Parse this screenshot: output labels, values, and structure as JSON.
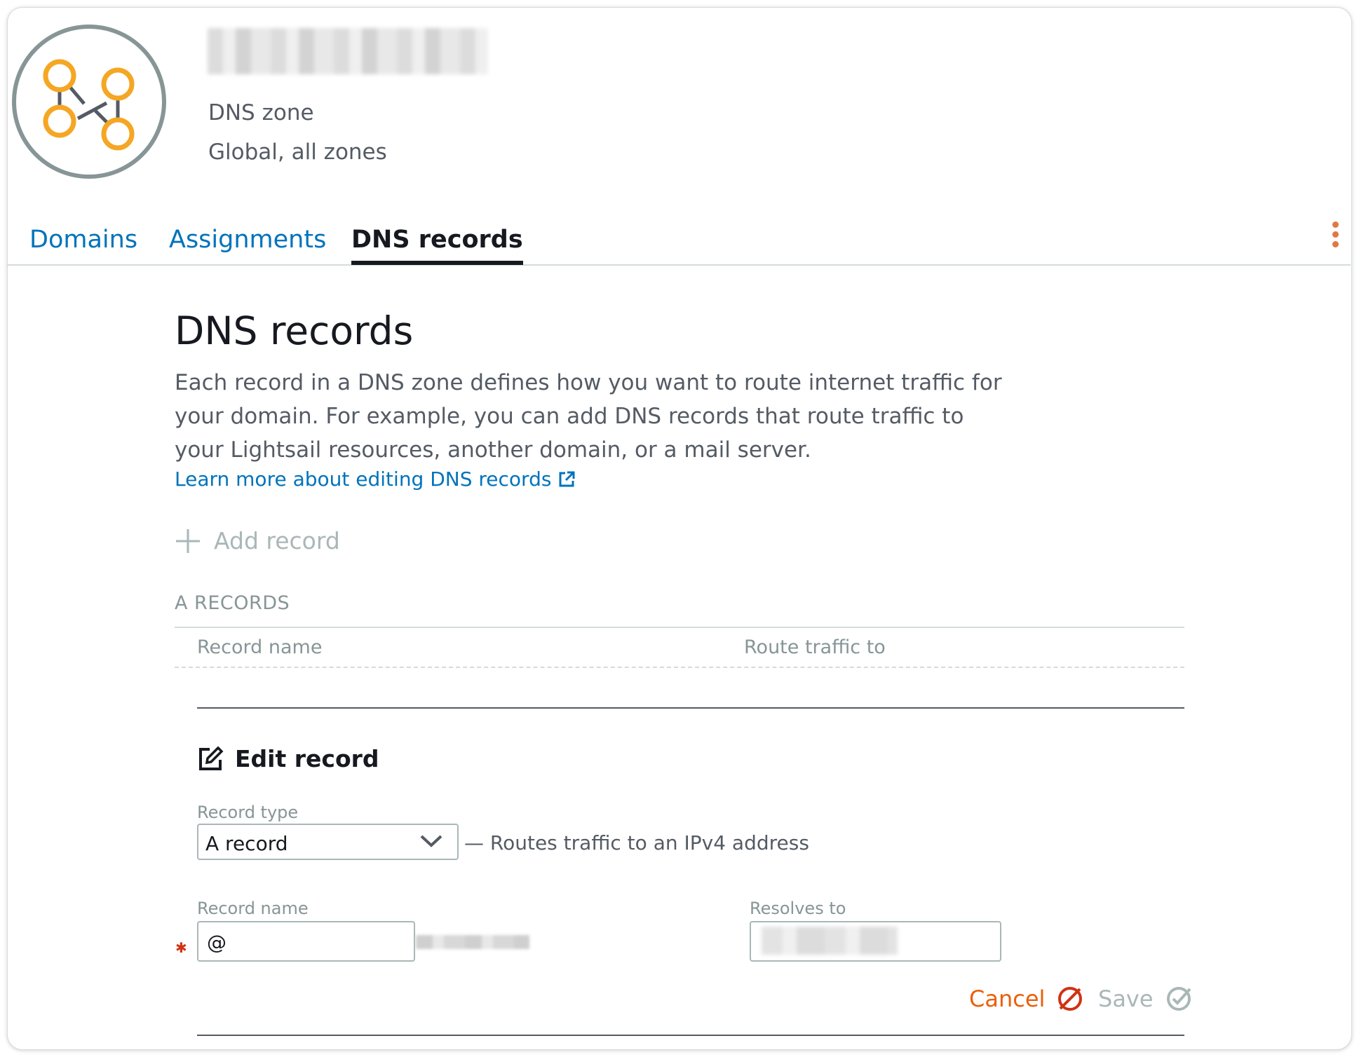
{
  "header": {
    "zone_type": "DNS zone",
    "zone_region": "Global, all zones",
    "zone_icon": "dns-zone-icon"
  },
  "tabs": [
    {
      "label": "Domains",
      "active": false
    },
    {
      "label": "Assignments",
      "active": false
    },
    {
      "label": "DNS records",
      "active": true
    }
  ],
  "main": {
    "title": "DNS records",
    "description": "Each record in a DNS zone defines how you want to route internet traffic for your domain. For example, you can add DNS records that route traffic to your Lightsail resources, another domain, or a mail server.",
    "learn_more": "Learn more about editing DNS records",
    "add_record": "Add record",
    "section_title": "A RECORDS",
    "columns": [
      "Record name",
      "Route traffic to"
    ]
  },
  "edit": {
    "title": "Edit record",
    "record_type_label": "Record type",
    "record_type_value": "A record",
    "record_type_note": "— Routes traffic to an IPv4 address",
    "record_name_label": "Record name",
    "record_name_value": "@",
    "resolves_label": "Resolves to",
    "cancel": "Cancel",
    "save": "Save"
  },
  "colors": {
    "accent_orange": "#eb5f07",
    "link_blue": "#0073bb",
    "icon_orange": "#f5a623",
    "cancel_icon": "#d13212"
  }
}
